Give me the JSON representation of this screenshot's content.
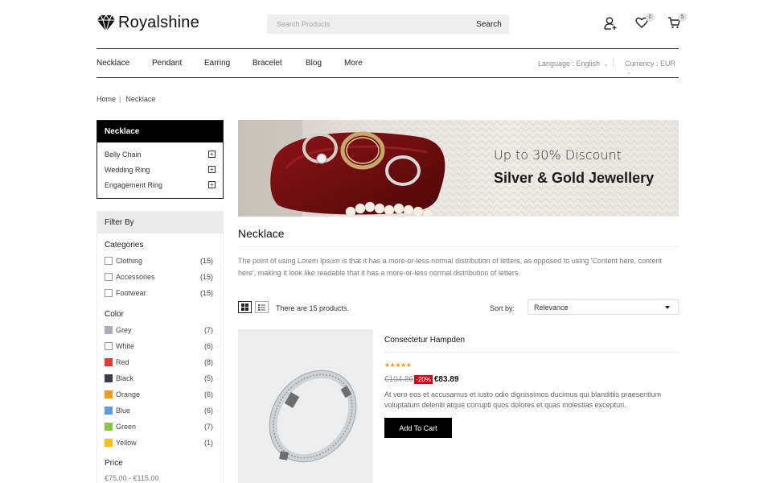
{
  "brand": {
    "name": "Royalshine"
  },
  "search": {
    "placeholder": "Search Products",
    "button_label": "Search"
  },
  "header": {
    "wishlist_count": "0",
    "cart_count": "5"
  },
  "nav": {
    "items": [
      "Necklace",
      "Pendant",
      "Earring",
      "Bracelet",
      "Blog",
      "More"
    ],
    "language": "Language : English",
    "currency": "Currency : EUR"
  },
  "breadcrumb": {
    "home": "Home",
    "current": "Necklace"
  },
  "sidebar": {
    "category_title": "Necklace",
    "subcategories": [
      "Belly Chain",
      "Wedding Ring",
      "Engagement Ring"
    ],
    "filter_title": "Filter By",
    "categories_title": "Categories",
    "categories": [
      {
        "label": "Clothing",
        "count": "(15)"
      },
      {
        "label": "Accessories",
        "count": "(15)"
      },
      {
        "label": "Footwear",
        "count": "(15)"
      }
    ],
    "color_title": "Color",
    "colors": [
      {
        "label": "Grey",
        "count": "(7)",
        "hex": "#a9aeb5"
      },
      {
        "label": "White",
        "count": "(6)",
        "hex": "#ffffff"
      },
      {
        "label": "Red",
        "count": "(8)",
        "hex": "#e53935"
      },
      {
        "label": "Black",
        "count": "(5)",
        "hex": "#3a3d46"
      },
      {
        "label": "Orange",
        "count": "(6)",
        "hex": "#f39a1d"
      },
      {
        "label": "Blue",
        "count": "(6)",
        "hex": "#5e9ce0"
      },
      {
        "label": "Green",
        "count": "(7)",
        "hex": "#8bc34a"
      },
      {
        "label": "Yellow",
        "count": "(1)",
        "hex": "#f4c21b"
      }
    ],
    "price_title": "Price",
    "price_range": "€75.00 - €115.00"
  },
  "banner": {
    "offer": "Up to 30% Discount",
    "title": "Silver & Gold Jewellery"
  },
  "main": {
    "title": "Necklace",
    "description": "The point of using Lorem Ipsum is that it has a more-or-less normal distribution of letters, as opposed to using 'Content here, content here', making it look like readable that it has a more-or-less normal distribution of letters.",
    "product_count": "There are 15 products.",
    "sort_label": "Sort by:",
    "sort_value": "Relevance"
  },
  "product": {
    "name": "Consectetur Hampden",
    "stars": "★★★★★",
    "rating": 5,
    "old_price": "€104.86",
    "discount": "-20%",
    "new_price": "€83.89",
    "description": "At vero eos et accusamus et iusto odio dignissimos ducimus qui blanditiis praesentium voluptatum deleniti atque corrupti quos dolores et quas molestias excepturi.",
    "cart_label": "Add To Cart"
  }
}
